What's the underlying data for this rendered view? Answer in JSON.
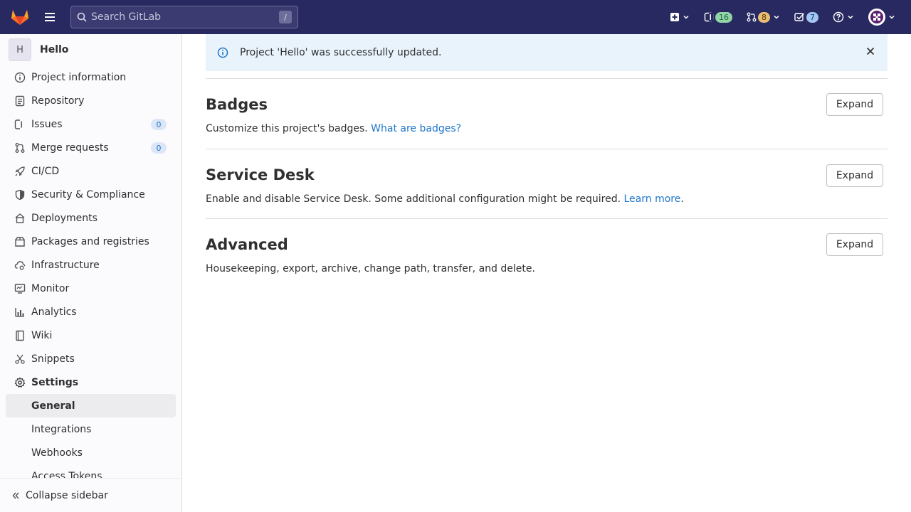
{
  "topbar": {
    "search_placeholder": "Search GitLab",
    "search_shortcut": "/",
    "issues_count": "16",
    "mr_count": "8",
    "todos_count": "7"
  },
  "sidebar": {
    "project_initial": "H",
    "project_name": "Hello",
    "items": [
      {
        "label": "Project information",
        "icon": "info-circle-icon"
      },
      {
        "label": "Repository",
        "icon": "doc-text-icon"
      },
      {
        "label": "Issues",
        "icon": "issues-icon",
        "badge": "0"
      },
      {
        "label": "Merge requests",
        "icon": "git-merge-icon",
        "badge": "0"
      },
      {
        "label": "CI/CD",
        "icon": "rocket-icon"
      },
      {
        "label": "Security & Compliance",
        "icon": "shield-icon"
      },
      {
        "label": "Deployments",
        "icon": "deployments-icon"
      },
      {
        "label": "Packages and registries",
        "icon": "package-icon"
      },
      {
        "label": "Infrastructure",
        "icon": "cloud-gear-icon"
      },
      {
        "label": "Monitor",
        "icon": "monitor-icon"
      },
      {
        "label": "Analytics",
        "icon": "chart-icon"
      },
      {
        "label": "Wiki",
        "icon": "book-icon"
      },
      {
        "label": "Snippets",
        "icon": "snippet-icon"
      },
      {
        "label": "Settings",
        "icon": "settings-icon"
      }
    ],
    "settings_sub": [
      {
        "label": "General"
      },
      {
        "label": "Integrations"
      },
      {
        "label": "Webhooks"
      },
      {
        "label": "Access Tokens"
      }
    ],
    "collapse_label": "Collapse sidebar"
  },
  "alert": {
    "message": "Project 'Hello' was successfully updated."
  },
  "sections": [
    {
      "title": "Badges",
      "text": "Customize this project's badges.",
      "link": "What are badges?",
      "after": "",
      "button": "Expand"
    },
    {
      "title": "Service Desk",
      "text": "Enable and disable Service Desk. Some additional configuration might be required.",
      "link": "Learn more",
      "after": ".",
      "button": "Expand"
    },
    {
      "title": "Advanced",
      "text": "Housekeeping, export, archive, change path, transfer, and delete.",
      "link": "",
      "after": "",
      "button": "Expand"
    }
  ],
  "colors": {
    "navbar": "#292961",
    "link": "#1f75cb",
    "alert_bg": "#e9f3fc"
  }
}
